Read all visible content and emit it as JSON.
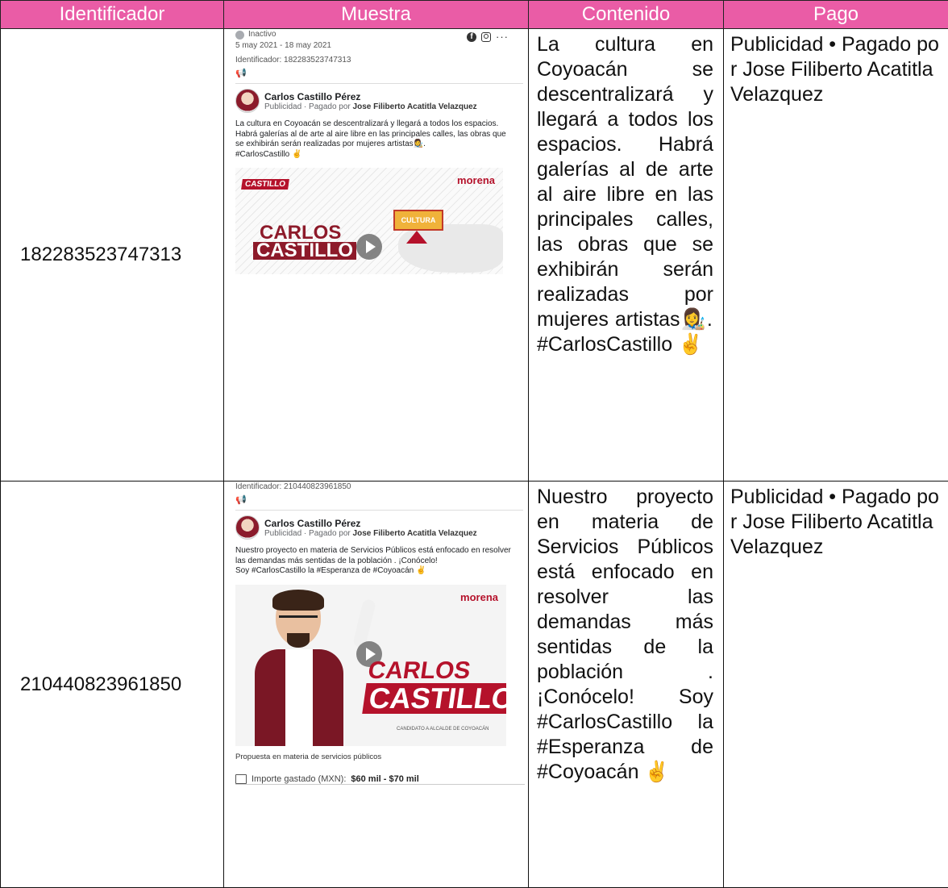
{
  "header": {
    "col1": "Identificador",
    "col2": "Muestra",
    "col3": "Contenido",
    "col4": "Pago"
  },
  "rows": [
    {
      "identificador": "182283523747313",
      "contenido": "La cultura en Coyoacán se descentralizará y llegará a todos los espacios. Habrá galerías al de arte al aire libre en las principales calles, las obras que se exhibirán serán realizadas por mujeres artistas👩‍🎨. #CarlosCastillo ✌️",
      "pago": "Publicidad • Pagado por Jose Filiberto Acatitla Velazquez",
      "muestra": {
        "status": "Inactivo",
        "dates": "5 may 2021 - 18 may 2021",
        "id_line": "Identificador: 182283523747313",
        "page_name": "Carlos Castillo Pérez",
        "sponsor_prefix": "Publicidad · Pagado por",
        "sponsor_name": "Jose Filiberto Acatitla Velazquez",
        "body": "La cultura en Coyoacán se descentralizará y llegará a todos los espacios. Habrá galerías al de arte al aire libre en las principales calles, las obras que se exhibirán serán realizadas por mujeres artistas👩‍🎨.\n#CarlosCastillo ✌️",
        "creative": {
          "tag": "CASTILLO",
          "brand": "morena",
          "banner": "CULTURA",
          "name_l1": "CARLOS",
          "name_l2": "CASTILLO"
        }
      }
    },
    {
      "identificador": "210440823961850",
      "contenido": "Nuestro proyecto en materia de Servicios Públicos está enfocado en resolver las demandas más sentidas de la población . ¡Conócelo! Soy #CarlosCastillo la #Esperanza de #Coyoacán ✌️",
      "pago": "Publicidad • Pagado por Jose Filiberto Acatitla Velazquez",
      "muestra": {
        "id_line": "Identificador: 210440823961850",
        "page_name": "Carlos Castillo Pérez",
        "sponsor_prefix": "Publicidad · Pagado por",
        "sponsor_name": "Jose Filiberto Acatitla Velazquez",
        "body": "Nuestro proyecto en materia de Servicios Públicos está enfocado en resolver las demandas más sentidas de la población . ¡Conócelo!\nSoy #CarlosCastillo la #Esperanza de #Coyoacán ✌️",
        "creative": {
          "brand": "morena",
          "name_l1": "CARLOS",
          "name_l2": "CASTILLO",
          "subtitle": "CANDIDATO A ALCALDE DE COYOACÁN"
        },
        "caption": "Propuesta en materia de servicios públicos",
        "spend_label": "Importe gastado (MXN):",
        "spend_value": "$60 mil - $70 mil"
      }
    }
  ],
  "icons": [
    "status-dot-icon",
    "facebook-icon",
    "instagram-icon",
    "more-options-icon",
    "megaphone-icon",
    "avatar",
    "play-icon",
    "bill-icon"
  ],
  "colors": {
    "header_bg": "#ea5ca6",
    "brand_red": "#b5122b"
  }
}
